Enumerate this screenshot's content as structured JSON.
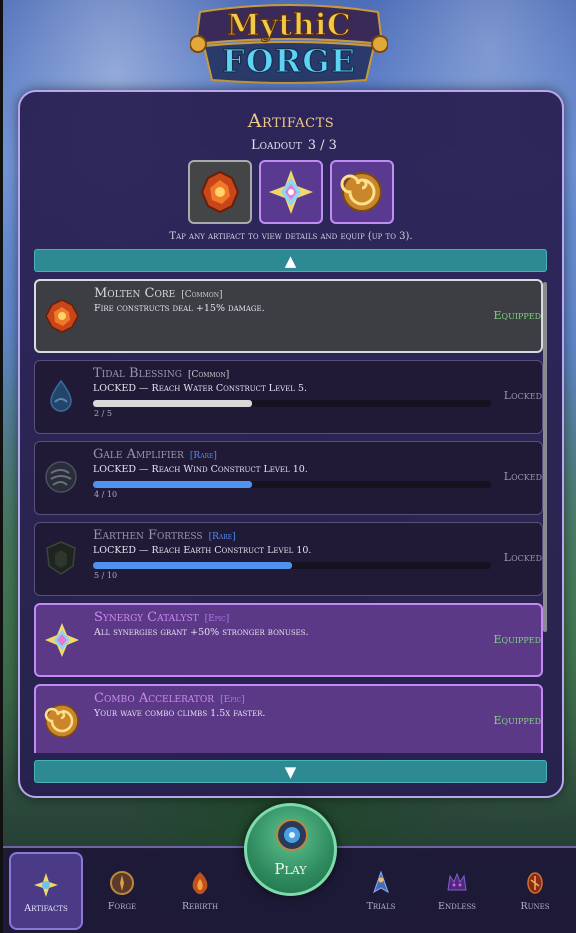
{
  "game": {
    "logo_line1": "MythiC",
    "logo_line2": "FORGE"
  },
  "panel": {
    "title": "Artifacts",
    "loadout_label": "Loadout",
    "loadout_value": "3 / 3",
    "hint": "Tap any artifact to view details and equip (up to 3).",
    "scroll_up": "▲",
    "scroll_down": "▼"
  },
  "artifacts": [
    {
      "name": "Molten Core",
      "rarity": "[Common]",
      "desc": "Fire constructs deal +15% damage.",
      "status": "Equipped",
      "progress_text": "",
      "progress": null
    },
    {
      "name": "Tidal Blessing",
      "rarity": "[Common]",
      "desc": "LOCKED — Reach Water Construct Level 5.",
      "status": "Locked",
      "progress_text": "2 / 5",
      "progress": 0.4
    },
    {
      "name": "Gale Amplifier",
      "rarity": "[Rare]",
      "desc": "LOCKED — Reach Wind Construct Level 10.",
      "status": "Locked",
      "progress_text": "4 / 10",
      "progress": 0.4
    },
    {
      "name": "Earthen Fortress",
      "rarity": "[Rare]",
      "desc": "LOCKED — Reach Earth Construct Level 10.",
      "status": "Locked",
      "progress_text": "5 / 10",
      "progress": 0.5
    },
    {
      "name": "Synergy Catalyst",
      "rarity": "[Epic]",
      "desc": "All synergies grant +50% stronger bonuses.",
      "status": "Equipped",
      "progress_text": "",
      "progress": null
    },
    {
      "name": "Combo Accelerator",
      "rarity": "[Epic]",
      "desc": "Your wave combo climbs 1.5x faster.",
      "status": "Equipped",
      "progress_text": "",
      "progress": null
    }
  ],
  "colors": {
    "common_bar": "#d9d9d9",
    "rare_bar": "#4f93ef",
    "equipped": "#7fd47f"
  },
  "nav": {
    "play": "Play",
    "items": [
      {
        "label": "Artifacts",
        "icon": "artifact-icon"
      },
      {
        "label": "Forge",
        "icon": "forge-icon"
      },
      {
        "label": "Rebirth",
        "icon": "rebirth-icon"
      },
      {
        "label": "Trials",
        "icon": "trials-icon"
      },
      {
        "label": "Endless",
        "icon": "endless-icon"
      },
      {
        "label": "Runes",
        "icon": "runes-icon"
      }
    ]
  }
}
